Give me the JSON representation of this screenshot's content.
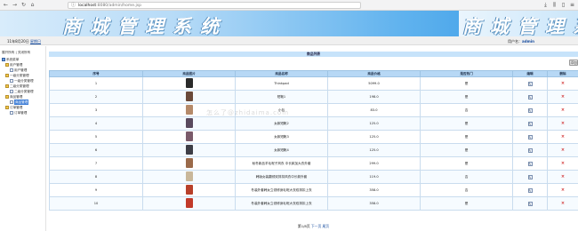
{
  "browser": {
    "back_icon": "back-arrow-icon",
    "forward_icon": "forward-arrow-icon",
    "reload_icon": "reload-icon",
    "home_icon": "home-icon",
    "url_host": "localhost",
    "url_path": ":8080/admin/home.jsp",
    "right_icons": [
      "download-icon",
      "library-icon",
      "sidebar-icon",
      "menu-icon"
    ]
  },
  "banner": {
    "title": "商城管理系统",
    "title_repeat": "商城管理系统"
  },
  "infobar": {
    "date": "11年8月20日",
    "weekday": "星期日",
    "user_label": "用户名：",
    "user_name": "admin"
  },
  "sidebar": {
    "quick_links": "展开所有 | 关闭所有",
    "tree": [
      {
        "label": "系统菜单",
        "level": 0,
        "icon": "root-icon"
      },
      {
        "label": "用户管理",
        "level": 1,
        "icon": "folder-icon"
      },
      {
        "label": "用户管理",
        "level": 2,
        "icon": "doc-icon"
      },
      {
        "label": "一级分类管理",
        "level": 1,
        "icon": "folder-icon"
      },
      {
        "label": "一级分类管理",
        "level": 2,
        "icon": "doc-icon"
      },
      {
        "label": "二级分类管理",
        "level": 1,
        "icon": "folder-icon"
      },
      {
        "label": "二级分类管理",
        "level": 2,
        "icon": "doc-icon"
      },
      {
        "label": "商品管理",
        "level": 1,
        "icon": "folder-icon"
      },
      {
        "label": "商品管理",
        "level": 2,
        "icon": "doc-icon",
        "selected": true
      },
      {
        "label": "订单管理",
        "level": 1,
        "icon": "folder-icon"
      },
      {
        "label": "订单管理",
        "level": 2,
        "icon": "doc-icon"
      }
    ]
  },
  "main": {
    "list_title": "商品列表",
    "add_label": "添加",
    "columns": [
      "序号",
      "商品图片",
      "商品名称",
      "商品价格",
      "是否热门",
      "编辑",
      "删除"
    ],
    "rows": [
      {
        "no": "1",
        "name": "Thinkpad",
        "price": "5099.0",
        "hot": "是",
        "thumb": "#2a2a2a"
      },
      {
        "no": "2",
        "name": "短靴1",
        "price": "198.0",
        "hot": "是",
        "thumb": "#6b4a3a"
      },
      {
        "no": "3",
        "name": "小包",
        "price": "83.0",
        "hot": "否",
        "thumb": "#b58a6a"
      },
      {
        "no": "4",
        "name": "女款短靴2",
        "price": "125.0",
        "hot": "是",
        "thumb": "#5a4a5e"
      },
      {
        "no": "5",
        "name": "女款短靴3",
        "price": "125.0",
        "hot": "是",
        "thumb": "#7a5a6a"
      },
      {
        "no": "6",
        "name": "女款短靴4",
        "price": "125.0",
        "hot": "是",
        "thumb": "#3e3e46"
      },
      {
        "no": "7",
        "name": "秋冬新品羊毛呢子风衣 中长款加大衣外套",
        "price": "299.0",
        "hot": "是",
        "thumb": "#9a6a4a"
      },
      {
        "no": "8",
        "name": "韩版女装翻领双排扣风衣中长款外套",
        "price": "119.0",
        "hot": "否",
        "thumb": "#c9b79a"
      },
      {
        "no": "9",
        "name": "冬装外套韩女立领修身毛呢大衣双排扣上衣",
        "price": "358.0",
        "hot": "否",
        "thumb": "#b8402a"
      },
      {
        "no": "10",
        "name": "冬装外套韩女立领修身毛呢大衣双排扣上衣",
        "price": "358.0",
        "hot": "是",
        "thumb": "#c23a2a"
      }
    ],
    "edit_icon": "edit-icon",
    "delete_icon": "delete-icon",
    "pager": {
      "text": "第1/8页",
      "next": "下一页",
      "last": "尾页"
    }
  },
  "watermark": "怎么了@zhidaima.com",
  "colors": {
    "banner_start": "#d8ecfb",
    "banner_end": "#2f95e4",
    "header_row": "#b7d8f5",
    "list_title_bar": "#c7e3fa",
    "delete_red": "#d02a2a"
  }
}
